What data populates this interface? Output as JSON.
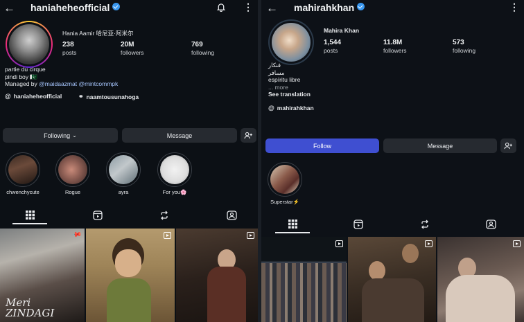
{
  "left": {
    "username": "haniaheheofficial",
    "full_name": "Hania Aamir 哈尼亚·阿米尔",
    "stats": [
      {
        "value": "238",
        "label": "posts"
      },
      {
        "value": "20M",
        "label": "followers"
      },
      {
        "value": "769",
        "label": "following"
      }
    ],
    "bio": {
      "line1": "partie du cirque",
      "line2": "pindi boy 🇵🇰",
      "managed_prefix": "Managed by",
      "managed_links": "@maidaazmat @mintcommpk"
    },
    "threads": [
      {
        "icon": "threads-icon",
        "label": "haniaheheofficial"
      },
      {
        "icon": "link-icon",
        "label": "naamtousunahoga"
      }
    ],
    "buttons": {
      "following": "Following",
      "message": "Message"
    },
    "highlights": [
      "chwenchycute",
      "Rogue",
      "ayra",
      "For you🌸"
    ],
    "grid_title": "Meri ZINDAGI"
  },
  "right": {
    "username": "mahirahkhan",
    "full_name": "Mahira Khan",
    "stats": [
      {
        "value": "1,544",
        "label": "posts"
      },
      {
        "value": "11.8M",
        "label": "followers"
      },
      {
        "value": "573",
        "label": "following"
      }
    ],
    "bio": {
      "line1": "فنکار",
      "line2": "مسافر",
      "line3": "espíritu libre",
      "more": "... more",
      "translation": "See translation"
    },
    "threads": {
      "icon": "threads-icon",
      "label": "mahirahkhan"
    },
    "buttons": {
      "follow": "Follow",
      "message": "Message"
    },
    "highlights": [
      "Superstar⚡"
    ]
  },
  "colors": {
    "accent_blue": "#3f4fd1",
    "verified": "#3897f0",
    "background": "#0c1015"
  }
}
